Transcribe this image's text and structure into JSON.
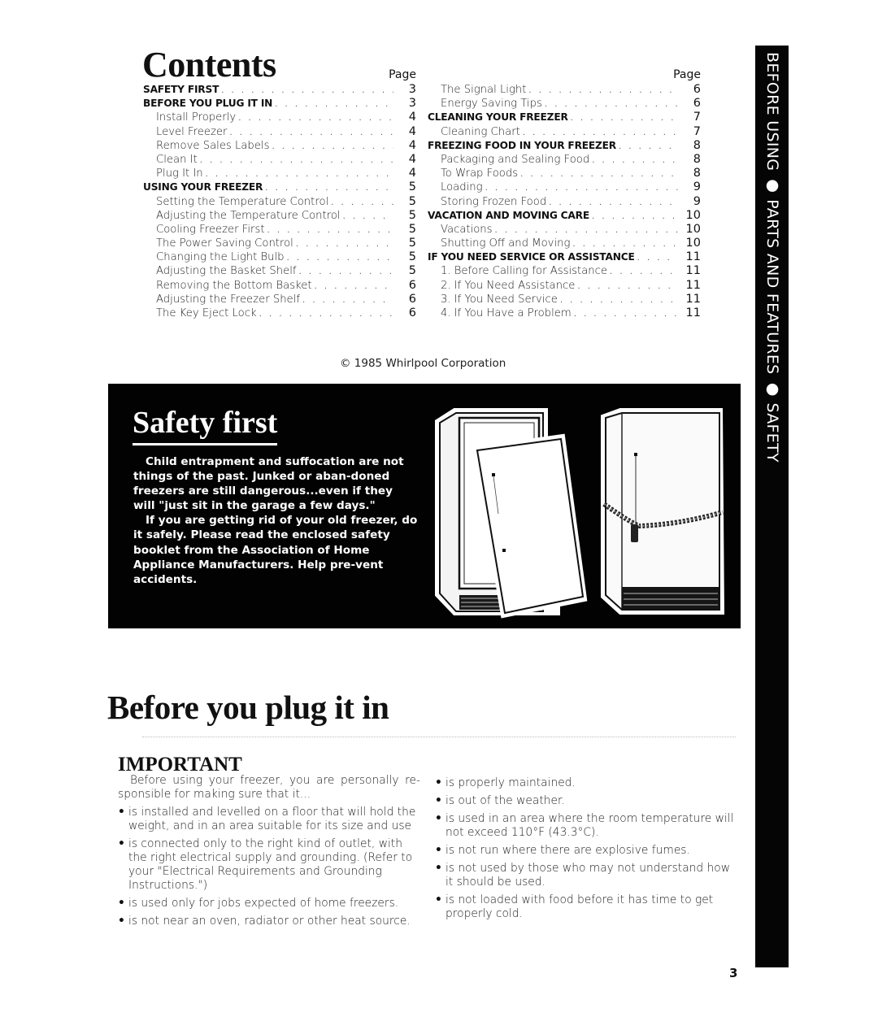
{
  "side_tab": {
    "text": "BEFORE USING ● PARTS AND FEATURES ● SAFETY"
  },
  "contents": {
    "title": "Contents",
    "page_header": "Page",
    "left_column": [
      {
        "label": "SAFETY FIRST",
        "page": "3",
        "style": "bold"
      },
      {
        "label": "BEFORE YOU PLUG IT IN",
        "page": "3",
        "style": "bold"
      },
      {
        "label": "Install Properly",
        "page": "4",
        "style": "sub"
      },
      {
        "label": "Level Freezer",
        "page": "4",
        "style": "sub"
      },
      {
        "label": "Remove Sales Labels",
        "page": "4",
        "style": "sub"
      },
      {
        "label": "Clean It",
        "page": "4",
        "style": "sub"
      },
      {
        "label": "Plug It In",
        "page": "4",
        "style": "sub"
      },
      {
        "label": "USING YOUR FREEZER",
        "page": "5",
        "style": "bold"
      },
      {
        "label": "Setting the Temperature Control",
        "page": "5",
        "style": "sub"
      },
      {
        "label": "Adjusting the Temperature Control",
        "page": "5",
        "style": "sub"
      },
      {
        "label": "Cooling Freezer First",
        "page": "5",
        "style": "sub"
      },
      {
        "label": "The Power Saving Control",
        "page": "5",
        "style": "sub"
      },
      {
        "label": "Changing the Light Bulb",
        "page": "5",
        "style": "sub"
      },
      {
        "label": "Adjusting the Basket Shelf",
        "page": "5",
        "style": "sub"
      },
      {
        "label": "Removing the Bottom Basket",
        "page": "6",
        "style": "sub"
      },
      {
        "label": "Adjusting the Freezer Shelf",
        "page": "6",
        "style": "sub"
      },
      {
        "label": "The Key Eject Lock",
        "page": "6",
        "style": "sub"
      }
    ],
    "right_column": [
      {
        "label": "The Signal Light",
        "page": "6",
        "style": "sub"
      },
      {
        "label": "Energy Saving Tips",
        "page": "6",
        "style": "sub"
      },
      {
        "label": "CLEANING YOUR FREEZER",
        "page": "7",
        "style": "bold"
      },
      {
        "label": "Cleaning Chart",
        "page": "7",
        "style": "sub"
      },
      {
        "label": "FREEZING FOOD IN YOUR FREEZER",
        "page": "8",
        "style": "bold"
      },
      {
        "label": "Packaging and Sealing Food",
        "page": "8",
        "style": "sub"
      },
      {
        "label": "To Wrap Foods",
        "page": "8",
        "style": "sub"
      },
      {
        "label": "Loading",
        "page": "9",
        "style": "sub"
      },
      {
        "label": "Storing Frozen Food",
        "page": "9",
        "style": "sub"
      },
      {
        "label": "VACATION AND MOVING CARE",
        "page": "10",
        "style": "bold"
      },
      {
        "label": "Vacations",
        "page": "10",
        "style": "sub"
      },
      {
        "label": "Shutting Off and Moving",
        "page": "10",
        "style": "sub"
      },
      {
        "label": "IF YOU NEED SERVICE OR ASSISTANCE",
        "page": "11",
        "style": "bold"
      },
      {
        "label": "1. Before Calling for Assistance",
        "page": "11",
        "style": "sub"
      },
      {
        "label": "2. If You Need Assistance",
        "page": "11",
        "style": "sub"
      },
      {
        "label": "3. If You Need Service",
        "page": "11",
        "style": "sub"
      },
      {
        "label": "4. If You Have a Problem",
        "page": "11",
        "style": "sub"
      }
    ]
  },
  "copyright": "© 1985 Whirlpool Corporation",
  "safety": {
    "title": "Safety first",
    "paragraphs": [
      "Child entrapment and suffocation are not things of the past. Junked or aban-doned freezers are still dangerous...even if they will \"just sit in the garage a few days.\"",
      "If you are getting rid of your old freezer, do it safely. Please read the enclosed safety booklet from the Association of Home Appliance Manufacturers. Help pre-vent accidents."
    ],
    "illustration": "freezer-door-removed-and-chained-freezer"
  },
  "before_plug": {
    "title": "Before you plug it in",
    "important_heading": "IMPORTANT",
    "intro": "Before using your freezer, you are personally re-sponsible for making sure that it...",
    "left_bullets": [
      "is installed and levelled on a floor that will hold the weight, and in an area suitable for its size and use",
      "is connected only to the right kind of outlet, with the right electrical supply and grounding. (Refer to your \"Electrical Requirements and Grounding Instructions.\")",
      "is used only for jobs expected of home freezers.",
      "is not near an oven, radiator or other heat source."
    ],
    "right_bullets": [
      "is properly maintained.",
      "is out of the weather.",
      "is used in an area where the room temperature will not exceed 110°F (43.3°C).",
      "is not run where there are explosive fumes.",
      "is not used by those who may not understand how it should be used.",
      "is not loaded with food before it has time to get properly cold."
    ]
  },
  "page_number": "3"
}
